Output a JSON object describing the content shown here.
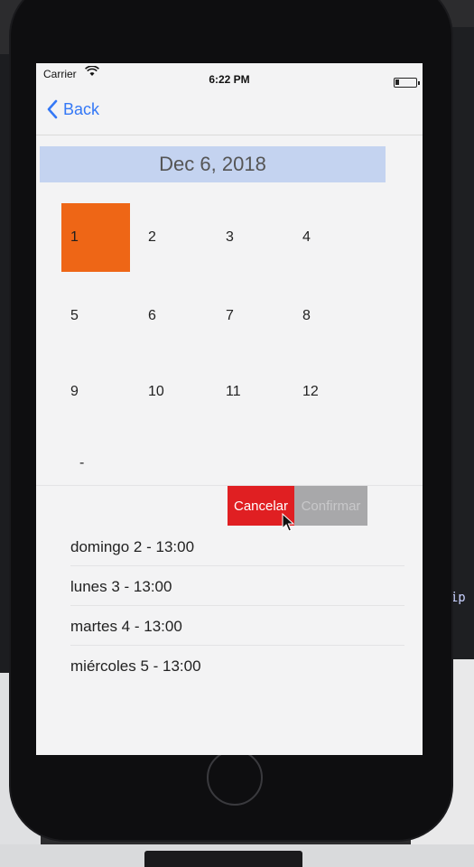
{
  "status_bar": {
    "carrier": "Carrier",
    "time": "6:22 PM"
  },
  "nav": {
    "back_label": "Back"
  },
  "date_header": "Dec 6, 2018",
  "grid": {
    "numbers": [
      "1",
      "2",
      "3",
      "4",
      "5",
      "6",
      "7",
      "8",
      "9",
      "10",
      "11",
      "12"
    ],
    "selected": "1",
    "selected_color": "#ee6616",
    "trailing": "-"
  },
  "actions": {
    "cancel_label": "Cancelar",
    "confirm_label": "Confirmar"
  },
  "schedule": [
    "domingo 2 - 13:00",
    "lunes 3 - 13:00",
    "martes 4 - 13:00",
    "miércoles 5 - 13:00"
  ],
  "background_code": {
    "paren": "))",
    "brace": "}",
    "crip": "crip"
  }
}
